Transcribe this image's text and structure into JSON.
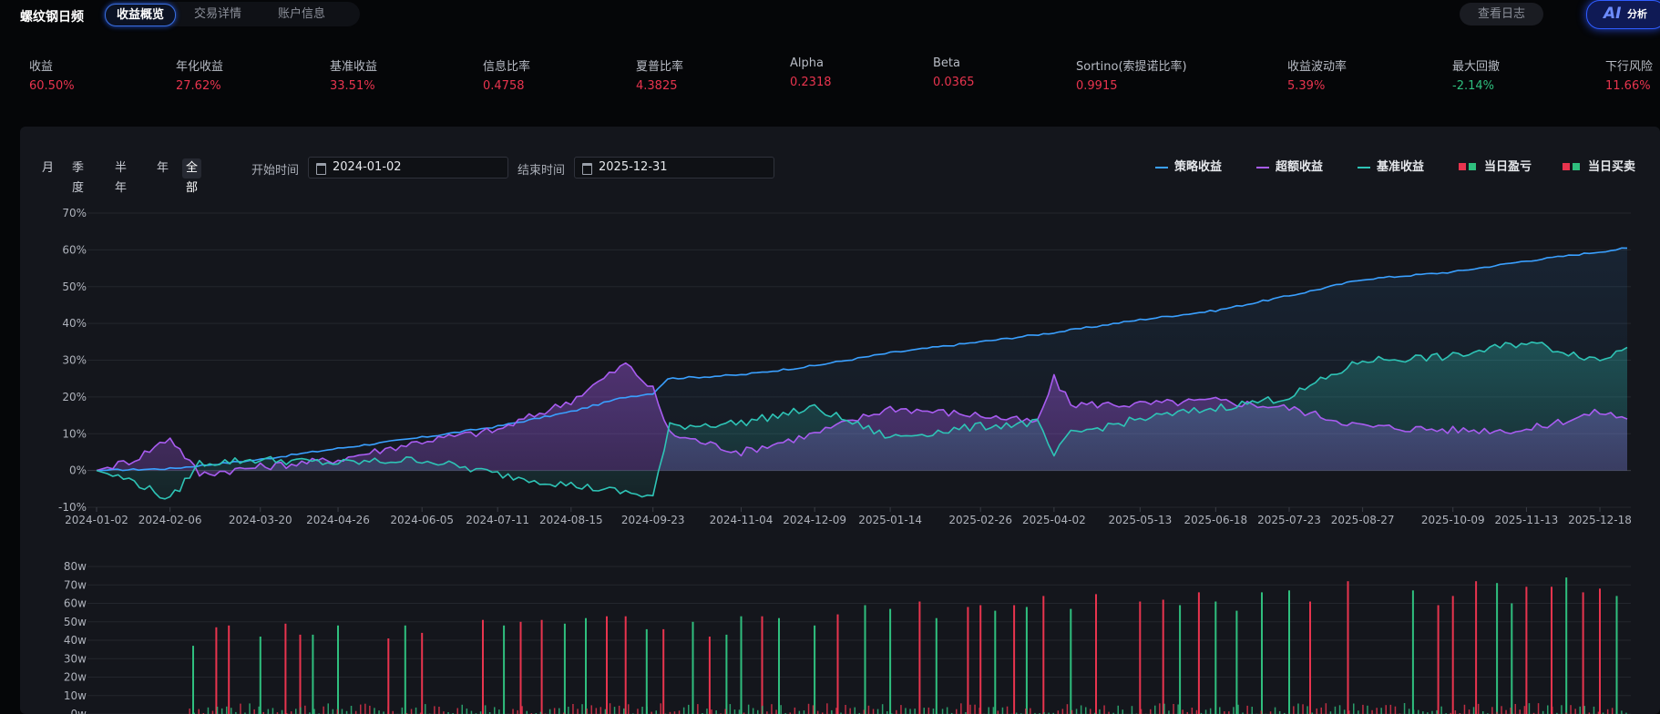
{
  "app": {
    "title": "螺纹钢日频"
  },
  "tabs": [
    {
      "label": "收益概览",
      "active": true
    },
    {
      "label": "交易详情",
      "active": false
    },
    {
      "label": "账户信息",
      "active": false
    }
  ],
  "header": {
    "log_button": "查看日志",
    "ai_button": {
      "icon": "AI",
      "label": "分析"
    }
  },
  "metrics": [
    {
      "label": "收益",
      "value": "60.50%",
      "color": "#e8344e"
    },
    {
      "label": "年化收益",
      "value": "27.62%",
      "color": "#e8344e"
    },
    {
      "label": "基准收益",
      "value": "33.51%",
      "color": "#e8344e"
    },
    {
      "label": "信息比率",
      "value": "0.4758",
      "color": "#e8344e"
    },
    {
      "label": "夏普比率",
      "value": "4.3825",
      "color": "#e8344e"
    },
    {
      "label": "Alpha",
      "value": "0.2318",
      "color": "#e8344e"
    },
    {
      "label": "Beta",
      "value": "0.0365",
      "color": "#e8344e"
    },
    {
      "label": "Sortino(索提诺比率)",
      "value": "0.9915",
      "color": "#e8344e"
    },
    {
      "label": "收益波动率",
      "value": "5.39%",
      "color": "#e8344e"
    },
    {
      "label": "最大回撤",
      "value": "-2.14%",
      "color": "#2fbf7e"
    },
    {
      "label": "下行风险",
      "value": "11.66%",
      "color": "#e8344e"
    }
  ],
  "controls": {
    "periods": [
      {
        "label": "月",
        "active": false
      },
      {
        "label": "季度",
        "active": false
      },
      {
        "label": "半年",
        "active": false
      },
      {
        "label": "年",
        "active": false
      },
      {
        "label": "全部",
        "active": true
      }
    ],
    "start_label": "开始时间",
    "start_value": "2024-01-02",
    "end_label": "结束时间",
    "end_value": "2025-12-31"
  },
  "legend": [
    {
      "label": "策略收益",
      "kind": "line",
      "colors": [
        "#3aa0ff"
      ]
    },
    {
      "label": "超额收益",
      "kind": "line",
      "colors": [
        "#a85cf0"
      ]
    },
    {
      "label": "基准收益",
      "kind": "line",
      "colors": [
        "#2ec4b6"
      ]
    },
    {
      "label": "当日盈亏",
      "kind": "squares",
      "colors": [
        "#e8344e",
        "#2fbf7e"
      ]
    },
    {
      "label": "当日买卖",
      "kind": "squares",
      "colors": [
        "#e8344e",
        "#2fbf7e"
      ]
    }
  ],
  "chart_data": [
    {
      "type": "line",
      "x_ticks": [
        "2024-01-02",
        "2024-02-06",
        "2024-03-20",
        "2024-04-26",
        "2024-06-05",
        "2024-07-11",
        "2024-08-15",
        "2024-09-23",
        "2024-11-04",
        "2024-12-09",
        "2025-01-14",
        "2025-02-26",
        "2025-04-02",
        "2025-05-13",
        "2025-06-18",
        "2025-07-23",
        "2025-08-27",
        "2025-10-09",
        "2025-11-13",
        "2025-12-18"
      ],
      "y_ticks": [
        "-10%",
        "0%",
        "10%",
        "20%",
        "30%",
        "40%",
        "50%",
        "60%",
        "70%"
      ],
      "ylim": [
        -10,
        70
      ],
      "y_unit": "%",
      "series": [
        {
          "name": "策略收益",
          "color": "#3aa0ff",
          "x": [
            "2024-01-02",
            "2024-02-06",
            "2024-03-20",
            "2024-04-26",
            "2024-06-05",
            "2024-07-11",
            "2024-08-15",
            "2024-09-10",
            "2024-09-23",
            "2024-09-30",
            "2024-11-04",
            "2024-12-09",
            "2025-01-14",
            "2025-02-26",
            "2025-04-02",
            "2025-05-13",
            "2025-06-18",
            "2025-07-23",
            "2025-08-27",
            "2025-10-09",
            "2025-11-13",
            "2025-12-18",
            "2025-12-31"
          ],
          "y": [
            0,
            0.5,
            3,
            6,
            9,
            12,
            16,
            20,
            21,
            25,
            26,
            28.5,
            32,
            35,
            37.5,
            41,
            43.5,
            47.5,
            52,
            54,
            57,
            59.5,
            60.5
          ]
        },
        {
          "name": "超额收益",
          "color": "#a85cf0",
          "x": [
            "2024-01-02",
            "2024-01-20",
            "2024-02-06",
            "2024-02-20",
            "2024-03-20",
            "2024-04-26",
            "2024-06-05",
            "2024-07-11",
            "2024-08-15",
            "2024-09-10",
            "2024-09-23",
            "2024-10-01",
            "2024-11-04",
            "2024-12-09",
            "2025-01-14",
            "2025-02-26",
            "2025-03-25",
            "2025-04-02",
            "2025-04-10",
            "2025-05-13",
            "2025-06-18",
            "2025-07-23",
            "2025-08-27",
            "2025-10-09",
            "2025-11-13",
            "2025-12-18",
            "2025-12-31"
          ],
          "y": [
            0,
            3,
            9,
            -1,
            1,
            3,
            8,
            11,
            19,
            29,
            22,
            10,
            5,
            10,
            17,
            15,
            13,
            25,
            18,
            18,
            19,
            17,
            12,
            11,
            11,
            16,
            14
          ]
        },
        {
          "name": "基准收益",
          "color": "#2ec4b6",
          "x": [
            "2024-01-02",
            "2024-01-20",
            "2024-02-06",
            "2024-02-20",
            "2024-03-20",
            "2024-04-26",
            "2024-06-05",
            "2024-07-11",
            "2024-08-15",
            "2024-09-10",
            "2024-09-23",
            "2024-10-01",
            "2024-11-04",
            "2024-12-09",
            "2025-01-14",
            "2025-02-26",
            "2025-03-25",
            "2025-04-02",
            "2025-04-10",
            "2025-05-13",
            "2025-06-18",
            "2025-07-23",
            "2025-08-27",
            "2025-10-09",
            "2025-11-13",
            "2025-12-18",
            "2025-12-31"
          ],
          "y": [
            0,
            -3,
            -8,
            2,
            3,
            2,
            3,
            -1,
            -4,
            -6,
            -7,
            12,
            13,
            17,
            9,
            12,
            13,
            4,
            10,
            14,
            17,
            20,
            30,
            31,
            35,
            30,
            33.5
          ]
        }
      ]
    },
    {
      "type": "bar",
      "y_ticks": [
        "0w",
        "10w",
        "20w",
        "30w",
        "40w",
        "50w",
        "60w",
        "70w",
        "80w"
      ],
      "ylim": [
        0,
        80
      ],
      "y_unit": "w",
      "series": [
        {
          "name": "当日盈亏",
          "color_up": "#e8344e",
          "color_down": "#2fbf7e"
        }
      ],
      "bars": [
        {
          "date": "2024-02-17",
          "value": 37,
          "color": "green"
        },
        {
          "date": "2024-02-28",
          "value": 47,
          "color": "red"
        },
        {
          "date": "2024-03-05",
          "value": 48,
          "color": "red"
        },
        {
          "date": "2024-03-20",
          "value": 42,
          "color": "green"
        },
        {
          "date": "2024-04-01",
          "value": 49,
          "color": "red"
        },
        {
          "date": "2024-04-08",
          "value": 43,
          "color": "red"
        },
        {
          "date": "2024-04-14",
          "value": 43,
          "color": "green"
        },
        {
          "date": "2024-04-26",
          "value": 48,
          "color": "green"
        },
        {
          "date": "2024-05-20",
          "value": 41,
          "color": "red"
        },
        {
          "date": "2024-05-28",
          "value": 48,
          "color": "green"
        },
        {
          "date": "2024-06-05",
          "value": 44,
          "color": "red"
        },
        {
          "date": "2024-07-04",
          "value": 51,
          "color": "red"
        },
        {
          "date": "2024-07-14",
          "value": 48,
          "color": "green"
        },
        {
          "date": "2024-07-22",
          "value": 50,
          "color": "red"
        },
        {
          "date": "2024-08-01",
          "value": 51,
          "color": "red"
        },
        {
          "date": "2024-08-12",
          "value": 49,
          "color": "green"
        },
        {
          "date": "2024-08-22",
          "value": 52,
          "color": "green"
        },
        {
          "date": "2024-09-01",
          "value": 53,
          "color": "red"
        },
        {
          "date": "2024-09-10",
          "value": 53,
          "color": "red"
        },
        {
          "date": "2024-09-20",
          "value": 46,
          "color": "green"
        },
        {
          "date": "2024-09-28",
          "value": 46,
          "color": "red"
        },
        {
          "date": "2024-10-12",
          "value": 50,
          "color": "green"
        },
        {
          "date": "2024-10-20",
          "value": 42,
          "color": "red"
        },
        {
          "date": "2024-10-28",
          "value": 43,
          "color": "green"
        },
        {
          "date": "2024-11-04",
          "value": 53,
          "color": "green"
        },
        {
          "date": "2024-11-14",
          "value": 53,
          "color": "red"
        },
        {
          "date": "2024-11-22",
          "value": 52,
          "color": "green"
        },
        {
          "date": "2024-12-09",
          "value": 48,
          "color": "green"
        },
        {
          "date": "2024-12-20",
          "value": 54,
          "color": "red"
        },
        {
          "date": "2025-01-02",
          "value": 59,
          "color": "green"
        },
        {
          "date": "2025-01-14",
          "value": 57,
          "color": "green"
        },
        {
          "date": "2025-01-28",
          "value": 61,
          "color": "red"
        },
        {
          "date": "2025-02-05",
          "value": 52,
          "color": "green"
        },
        {
          "date": "2025-02-20",
          "value": 58,
          "color": "red"
        },
        {
          "date": "2025-02-26",
          "value": 59,
          "color": "red"
        },
        {
          "date": "2025-03-05",
          "value": 56,
          "color": "green"
        },
        {
          "date": "2025-03-14",
          "value": 59,
          "color": "red"
        },
        {
          "date": "2025-03-20",
          "value": 58,
          "color": "green"
        },
        {
          "date": "2025-03-28",
          "value": 64,
          "color": "red"
        },
        {
          "date": "2025-04-10",
          "value": 57,
          "color": "green"
        },
        {
          "date": "2025-04-22",
          "value": 65,
          "color": "red"
        },
        {
          "date": "2025-05-13",
          "value": 61,
          "color": "red"
        },
        {
          "date": "2025-05-24",
          "value": 62,
          "color": "red"
        },
        {
          "date": "2025-06-01",
          "value": 59,
          "color": "green"
        },
        {
          "date": "2025-06-10",
          "value": 66,
          "color": "red"
        },
        {
          "date": "2025-06-18",
          "value": 61,
          "color": "green"
        },
        {
          "date": "2025-06-28",
          "value": 56,
          "color": "green"
        },
        {
          "date": "2025-07-10",
          "value": 66,
          "color": "green"
        },
        {
          "date": "2025-07-23",
          "value": 67,
          "color": "green"
        },
        {
          "date": "2025-08-02",
          "value": 61,
          "color": "red"
        },
        {
          "date": "2025-08-20",
          "value": 72,
          "color": "red"
        },
        {
          "date": "2025-09-20",
          "value": 67,
          "color": "green"
        },
        {
          "date": "2025-10-02",
          "value": 59,
          "color": "red"
        },
        {
          "date": "2025-10-09",
          "value": 64,
          "color": "red"
        },
        {
          "date": "2025-10-20",
          "value": 72,
          "color": "red"
        },
        {
          "date": "2025-10-30",
          "value": 71,
          "color": "green"
        },
        {
          "date": "2025-11-06",
          "value": 60,
          "color": "green"
        },
        {
          "date": "2025-11-13",
          "value": 69,
          "color": "red"
        },
        {
          "date": "2025-11-25",
          "value": 69,
          "color": "red"
        },
        {
          "date": "2025-12-02",
          "value": 74,
          "color": "green"
        },
        {
          "date": "2025-12-10",
          "value": 66,
          "color": "red"
        },
        {
          "date": "2025-12-18",
          "value": 68,
          "color": "red"
        },
        {
          "date": "2025-12-26",
          "value": 64,
          "color": "green"
        }
      ]
    }
  ]
}
